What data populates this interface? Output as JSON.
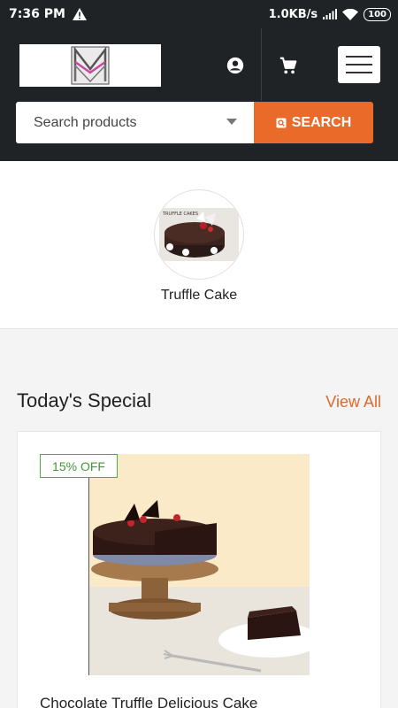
{
  "status_bar": {
    "time": "7:36 PM",
    "network_speed": "1.0KB/s",
    "battery": "100"
  },
  "header": {
    "search": {
      "placeholder": "Search products",
      "button_label": "SEARCH"
    }
  },
  "categories": [
    {
      "label": "Truffle Cake",
      "thumb_caption": "TRUFFLE CAKES"
    }
  ],
  "todays_special": {
    "title": "Today's Special",
    "view_all_label": "View All",
    "products": [
      {
        "name": "Chocolate Truffle Delicious Cake",
        "badge": "15% OFF"
      }
    ]
  },
  "colors": {
    "header_bg": "#1f2325",
    "accent_orange": "#ea6a2a",
    "badge_green": "#4caf3e"
  }
}
